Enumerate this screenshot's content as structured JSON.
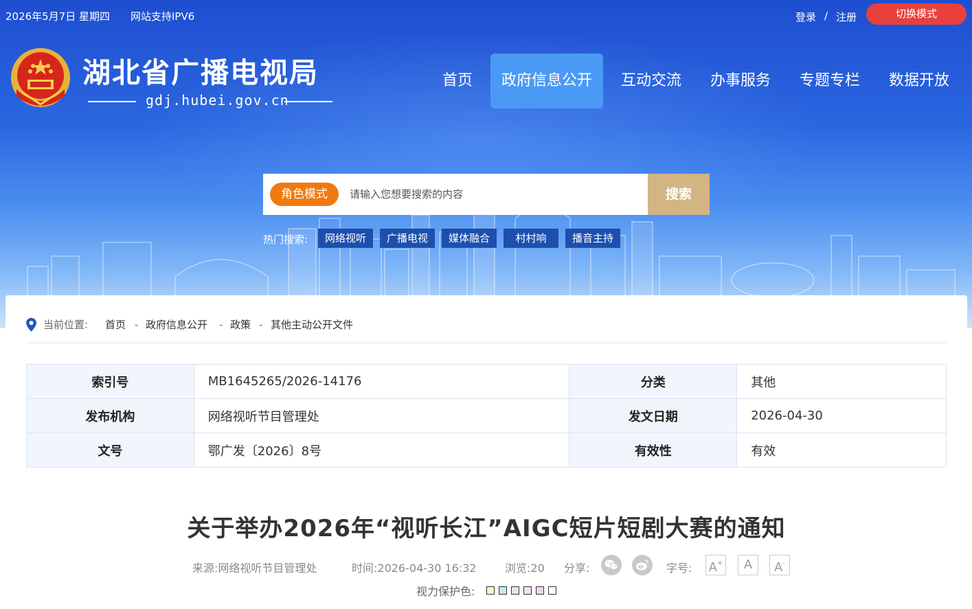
{
  "topbar": {
    "date": "2026年5月7日 星期四",
    "ipv6": "网站支持IPV6",
    "login": "登录",
    "slash": "/",
    "register": "注册",
    "switch_mode": "切换模式"
  },
  "header": {
    "title": "湖北省广播电视局",
    "domain": "gdj.hubei.gov.cn"
  },
  "nav": {
    "items": [
      "首页",
      "政府信息公开",
      "互动交流",
      "办事服务",
      "专题专栏",
      "数据开放"
    ],
    "active_index": 1
  },
  "search": {
    "role_mode": "角色模式",
    "placeholder": "请输入您想要搜索的内容",
    "button": "搜索"
  },
  "hot": {
    "label": "热门搜索:",
    "tags": [
      "网络视听",
      "广播电视",
      "媒体融合",
      "村村响",
      "播音主持"
    ]
  },
  "breadcrumb": {
    "label": "当前位置:",
    "items": [
      "首页",
      "政府信息公开",
      "政策",
      "其他主动公开文件"
    ],
    "separator": "-"
  },
  "meta": {
    "rows": [
      [
        {
          "k": "索引号",
          "v": "MB1645265/2026-14176"
        },
        {
          "k": "分类",
          "v": "其他"
        }
      ],
      [
        {
          "k": "发布机构",
          "v": "网络视听节目管理处"
        },
        {
          "k": "发文日期",
          "v": "2026-04-30"
        }
      ],
      [
        {
          "k": "文号",
          "v": "鄂广发〔2026〕8号"
        },
        {
          "k": "有效性",
          "v": "有效"
        }
      ]
    ]
  },
  "article": {
    "title": "关于举办2026年“视听长江”AIGC短片短剧大赛的通知",
    "source": "来源:网络视听节目管理处",
    "time": "时间:2026-04-30 16:32",
    "views": "浏览:20",
    "share_label": "分享:",
    "font_label": "字号:",
    "font_buttons": [
      "A",
      "A",
      "A"
    ],
    "eye_label": "视力保护色:"
  },
  "colors": {
    "accent_nav": "#4a9af5",
    "switch_red": "#e8413c",
    "role_orange": "#f07a10",
    "search_gold": "#d3b483",
    "hot_tag_bg": "#1d4fae",
    "eye_swatches": [
      "#fdf6c3",
      "#c5e6f7",
      "#e6e6e6",
      "#fbe0e6",
      "#e9d7f3",
      "#ffffff"
    ]
  }
}
